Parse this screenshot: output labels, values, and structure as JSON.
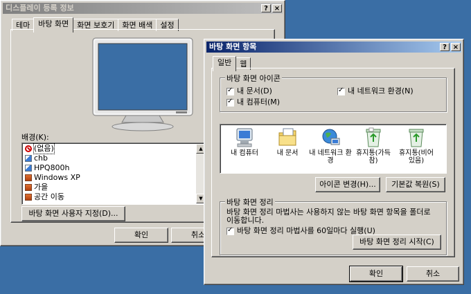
{
  "display_props": {
    "title": "디스플레이 등록 정보",
    "help_btn": "?",
    "close_btn": "×",
    "tabs": [
      "테마",
      "바탕 화면",
      "화면 보호기",
      "화면 배색",
      "설정"
    ],
    "background_label": "배경(K):",
    "backgrounds": [
      {
        "label": "(없음)",
        "icon": "none-icon",
        "selected": true
      },
      {
        "label": "chb",
        "icon": "image-file-icon"
      },
      {
        "label": "HPQ800h",
        "icon": "image-file-icon"
      },
      {
        "label": "Windows XP",
        "icon": "bitmap-file-icon"
      },
      {
        "label": "가을",
        "icon": "bitmap-file-icon"
      },
      {
        "label": "공간 이동",
        "icon": "bitmap-file-icon"
      }
    ],
    "customize_btn": "바탕 화면 사용자 지정(D)...",
    "ok_btn": "확인",
    "cancel_btn": "취소"
  },
  "desktop_items": {
    "title": "바탕 화면 항목",
    "help_btn": "?",
    "close_btn": "×",
    "tabs": [
      "일반",
      "웹"
    ],
    "icons_group_label": "바탕 화면 아이콘",
    "checkboxes": {
      "my_documents": "내 문서(D)",
      "my_computer": "내 컴퓨터(M)",
      "network": "내 네트워크 환경(N)"
    },
    "icons": [
      {
        "label": "내 컴퓨터",
        "icon": "my-computer-icon"
      },
      {
        "label": "내 문서",
        "icon": "my-documents-icon"
      },
      {
        "label": "내 네트워크 환경",
        "icon": "network-icon"
      },
      {
        "label": "휴지통(가득 참)",
        "icon": "recycle-bin-full-icon"
      },
      {
        "label": "휴지통(비어 있음)",
        "icon": "recycle-bin-empty-icon"
      }
    ],
    "change_icon_btn": "아이콘 변경(H)...",
    "restore_default_btn": "기본값 복원(S)",
    "cleanup_group_label": "바탕 화면 정리",
    "cleanup_desc": "바탕 화면 정리 마법사는 사용하지 않는 바탕 화면 항목을 폴더로 이동합니다.",
    "cleanup_checkbox": "바탕 화면 정리 마법사를 60일마다 실행(U)",
    "cleanup_now_btn": "바탕 화면 정리 시작(C)",
    "ok_btn": "확인",
    "cancel_btn": "취소"
  }
}
